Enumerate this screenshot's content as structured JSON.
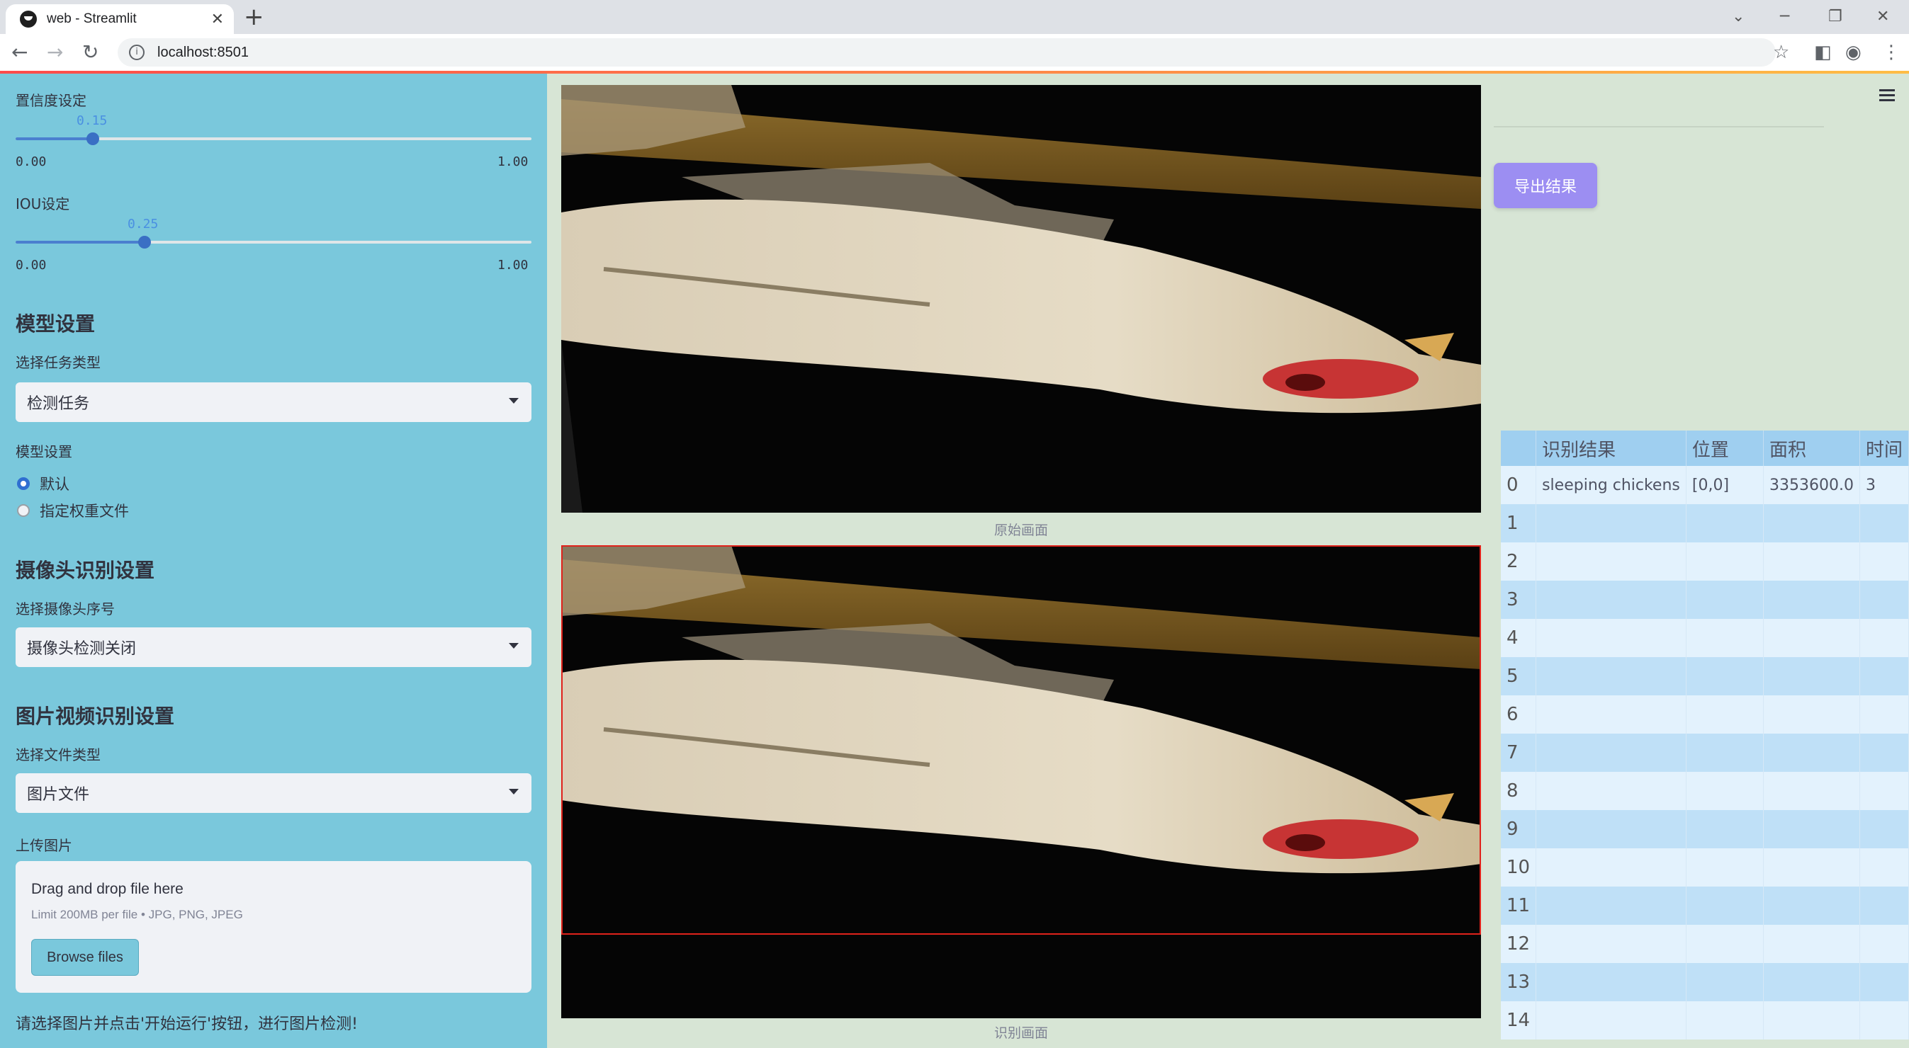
{
  "browser": {
    "tab_title": "web - Streamlit",
    "new_tab": "+",
    "url": "localhost:8501"
  },
  "sidebar": {
    "confidence": {
      "label": "置信度设定",
      "value": "0.15",
      "min": "0.00",
      "max": "1.00",
      "fraction": 0.15
    },
    "iou": {
      "label": "IOU设定",
      "value": "0.25",
      "min": "0.00",
      "max": "1.00",
      "fraction": 0.25
    },
    "model_section": {
      "heading": "模型设置",
      "task_label": "选择任务类型",
      "task_value": "检测任务",
      "model_label": "模型设置",
      "options": [
        "默认",
        "指定权重文件"
      ],
      "selected": 0
    },
    "camera_section": {
      "heading": "摄像头识别设置",
      "camera_label": "选择摄像头序号",
      "camera_value": "摄像头检测关闭"
    },
    "media_section": {
      "heading": "图片视频识别设置",
      "file_type_label": "选择文件类型",
      "file_type_value": "图片文件",
      "upload_label": "上传图片",
      "upload_title": "Drag and drop file here",
      "upload_limit": "Limit 200MB per file • JPG, PNG, JPEG",
      "browse_label": "Browse files"
    },
    "hint": "请选择图片并点击'开始运行'按钮，进行图片检测!"
  },
  "main": {
    "original_caption": "原始画面",
    "detected_caption": "识别画面",
    "export_label": "导出结果"
  },
  "table": {
    "columns": [
      "",
      "识别结果",
      "位置",
      "面积",
      "时间"
    ],
    "rows": [
      {
        "index": "0",
        "result": "sleeping chickens",
        "position": "[0,0]",
        "area": "3353600.0",
        "time": "3"
      },
      {
        "index": "1"
      },
      {
        "index": "2"
      },
      {
        "index": "3"
      },
      {
        "index": "4"
      },
      {
        "index": "5"
      },
      {
        "index": "6"
      },
      {
        "index": "7"
      },
      {
        "index": "8"
      },
      {
        "index": "9"
      },
      {
        "index": "10"
      },
      {
        "index": "11"
      },
      {
        "index": "12"
      },
      {
        "index": "13"
      },
      {
        "index": "14"
      }
    ]
  },
  "icons": [
    "streamlit-favicon",
    "close-icon",
    "back-icon",
    "forward-icon",
    "reload-icon",
    "info-icon",
    "star-icon",
    "sidepanel-icon",
    "profile-icon",
    "kebab-menu-icon",
    "hamburger-icon",
    "dropdown-caret-icon"
  ],
  "colors": {
    "sidebar_bg": "#7ac8dc",
    "main_bg": "#d7e5d5",
    "export_button": "#9c8ef2",
    "slider_accent": "#4a90e2",
    "table_header": "#9fcff0"
  }
}
